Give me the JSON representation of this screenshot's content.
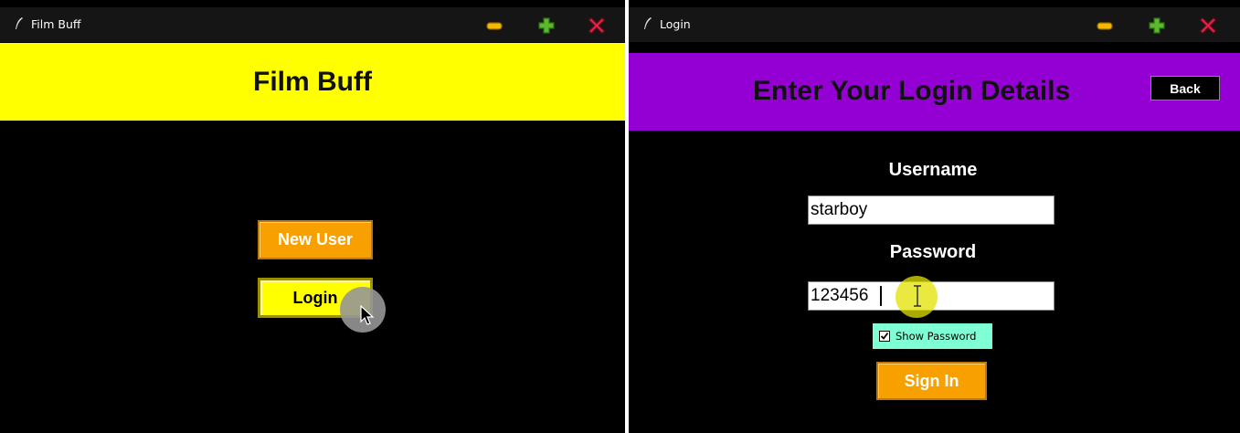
{
  "left_window": {
    "title": "Film Buff",
    "header": "Film Buff",
    "new_user_label": "New User",
    "login_label": "Login"
  },
  "right_window": {
    "title": "Login",
    "header": "Enter Your Login Details",
    "back_label": "Back",
    "username_label": "Username",
    "username_value": "starboy",
    "password_label": "Password",
    "password_value": "123456",
    "show_password_label": "Show Password",
    "show_password_checked": true,
    "sign_in_label": "Sign In"
  },
  "colors": {
    "left_header_bg": "#ffff00",
    "right_header_bg": "#9400d3",
    "button_orange": "#f8a000",
    "button_yellow": "#ffff00",
    "checkbox_bg": "#7fffd4",
    "minimize": "#f5b800",
    "maximize": "#5cb82e",
    "close": "#e8294c"
  },
  "icons": {
    "app_icon": "feather-icon",
    "minimize": "minimize-icon",
    "maximize": "maximize-icon",
    "close": "close-icon",
    "pointer": "mouse-pointer-icon",
    "text_cursor": "text-cursor-icon"
  }
}
